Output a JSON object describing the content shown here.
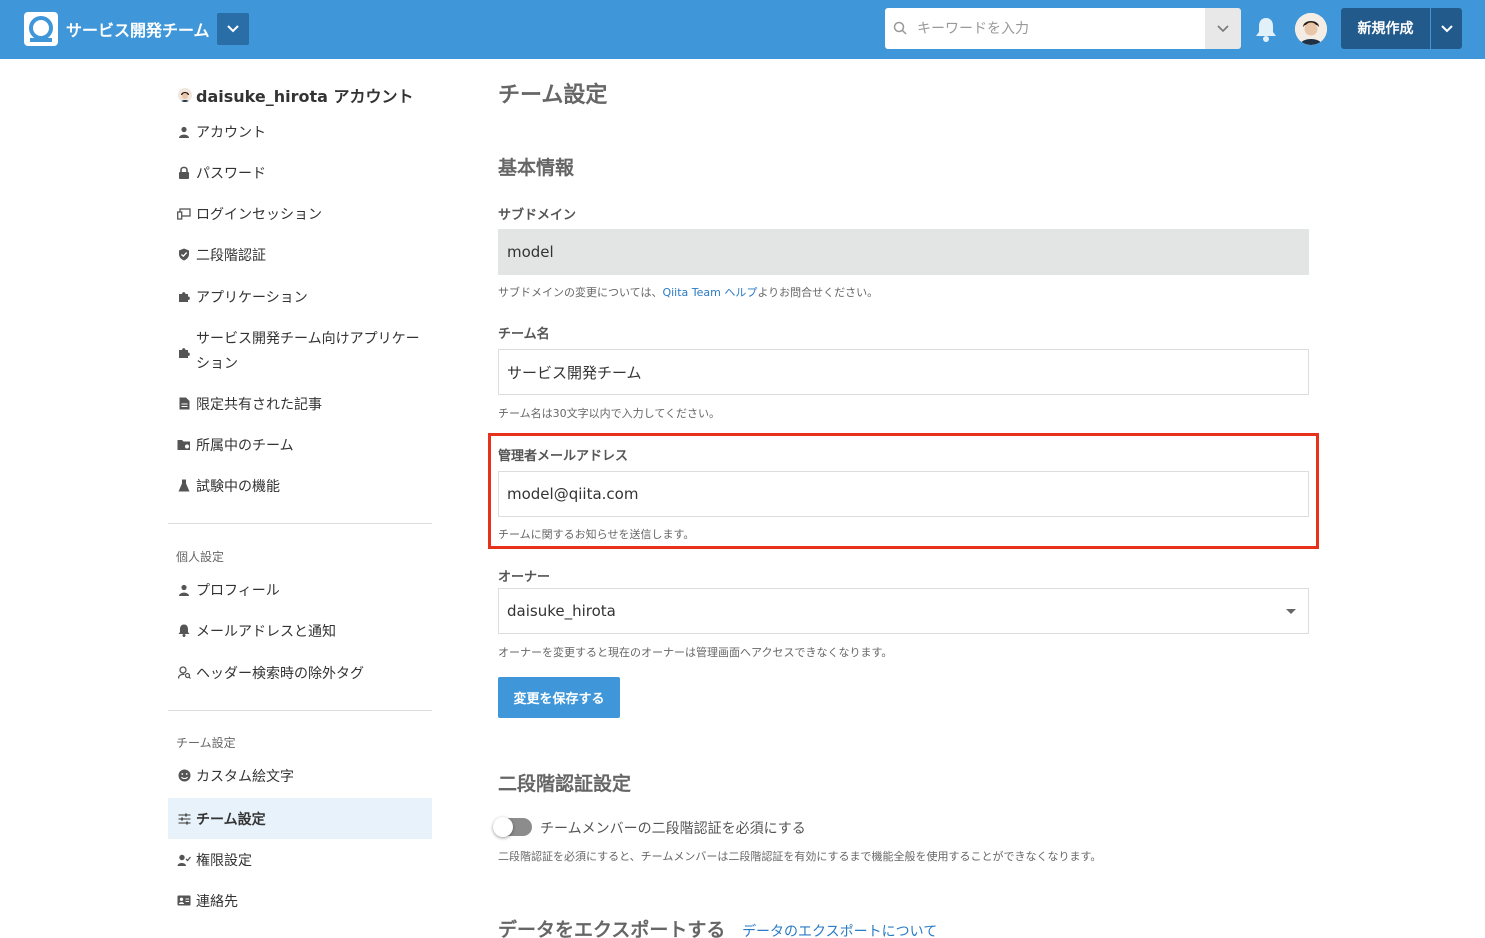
{
  "header": {
    "team_name": "サービス開発チーム",
    "search_placeholder": "キーワードを入力",
    "create_label": "新規作成",
    "brand_color": "#3f97d9",
    "accent_dark": "#235a8c"
  },
  "sidebar": {
    "account_title": "daisuke_hirota アカウント",
    "account_items": [
      {
        "label": "アカウント",
        "icon": "person-icon"
      },
      {
        "label": "パスワード",
        "icon": "lock-icon"
      },
      {
        "label": "ログインセッション",
        "icon": "devices-icon"
      },
      {
        "label": "二段階認証",
        "icon": "shield-icon"
      },
      {
        "label": "アプリケーション",
        "icon": "puzzle-icon"
      },
      {
        "label": "サービス開発チーム向けアプリケーション",
        "icon": "puzzle-icon"
      },
      {
        "label": "限定共有された記事",
        "icon": "document-icon"
      },
      {
        "label": "所属中のチーム",
        "icon": "team-folder-icon"
      },
      {
        "label": "試験中の機能",
        "icon": "flask-icon"
      }
    ],
    "personal_title": "個人設定",
    "personal_items": [
      {
        "label": "プロフィール",
        "icon": "person-icon"
      },
      {
        "label": "メールアドレスと通知",
        "icon": "bell-icon"
      },
      {
        "label": "ヘッダー検索時の除外タグ",
        "icon": "search-person-icon"
      }
    ],
    "team_title": "チーム設定",
    "team_items": [
      {
        "label": "カスタム絵文字",
        "icon": "smile-icon"
      },
      {
        "label": "チーム設定",
        "icon": "sliders-icon",
        "active": true
      },
      {
        "label": "権限設定",
        "icon": "user-check-icon"
      },
      {
        "label": "連絡先",
        "icon": "contact-card-icon"
      }
    ]
  },
  "main": {
    "page_title": "チーム設定",
    "basic_title": "基本情報",
    "subdomain": {
      "label": "サブドメイン",
      "value": "model",
      "hint_before": "サブドメインの変更については、",
      "hint_link": "Qiita Team ヘルプ",
      "hint_after": "よりお問合せください。"
    },
    "team_name": {
      "label": "チーム名",
      "value": "サービス開発チーム",
      "hint": "チーム名は30文字以内で入力してください。"
    },
    "admin_email": {
      "label": "管理者メールアドレス",
      "value": "model@qiita.com",
      "hint": "チームに関するお知らせを送信します。"
    },
    "owner": {
      "label": "オーナー",
      "value": "daisuke_hirota",
      "hint": "オーナーを変更すると現在のオーナーは管理画面へアクセスできなくなります。"
    },
    "save_label": "変更を保存する",
    "two_factor_title": "二段階認証設定",
    "two_factor_toggle_label": "チームメンバーの二段階認証を必須にする",
    "two_factor_toggle_on": false,
    "two_factor_hint": "二段階認証を必須にすると、チームメンバーは二段階認証を有効にするまで機能全般を使用することができなくなります。",
    "export_title": "データをエクスポートする",
    "export_link": "データのエクスポートについて"
  },
  "highlight_color": "#e8311b"
}
